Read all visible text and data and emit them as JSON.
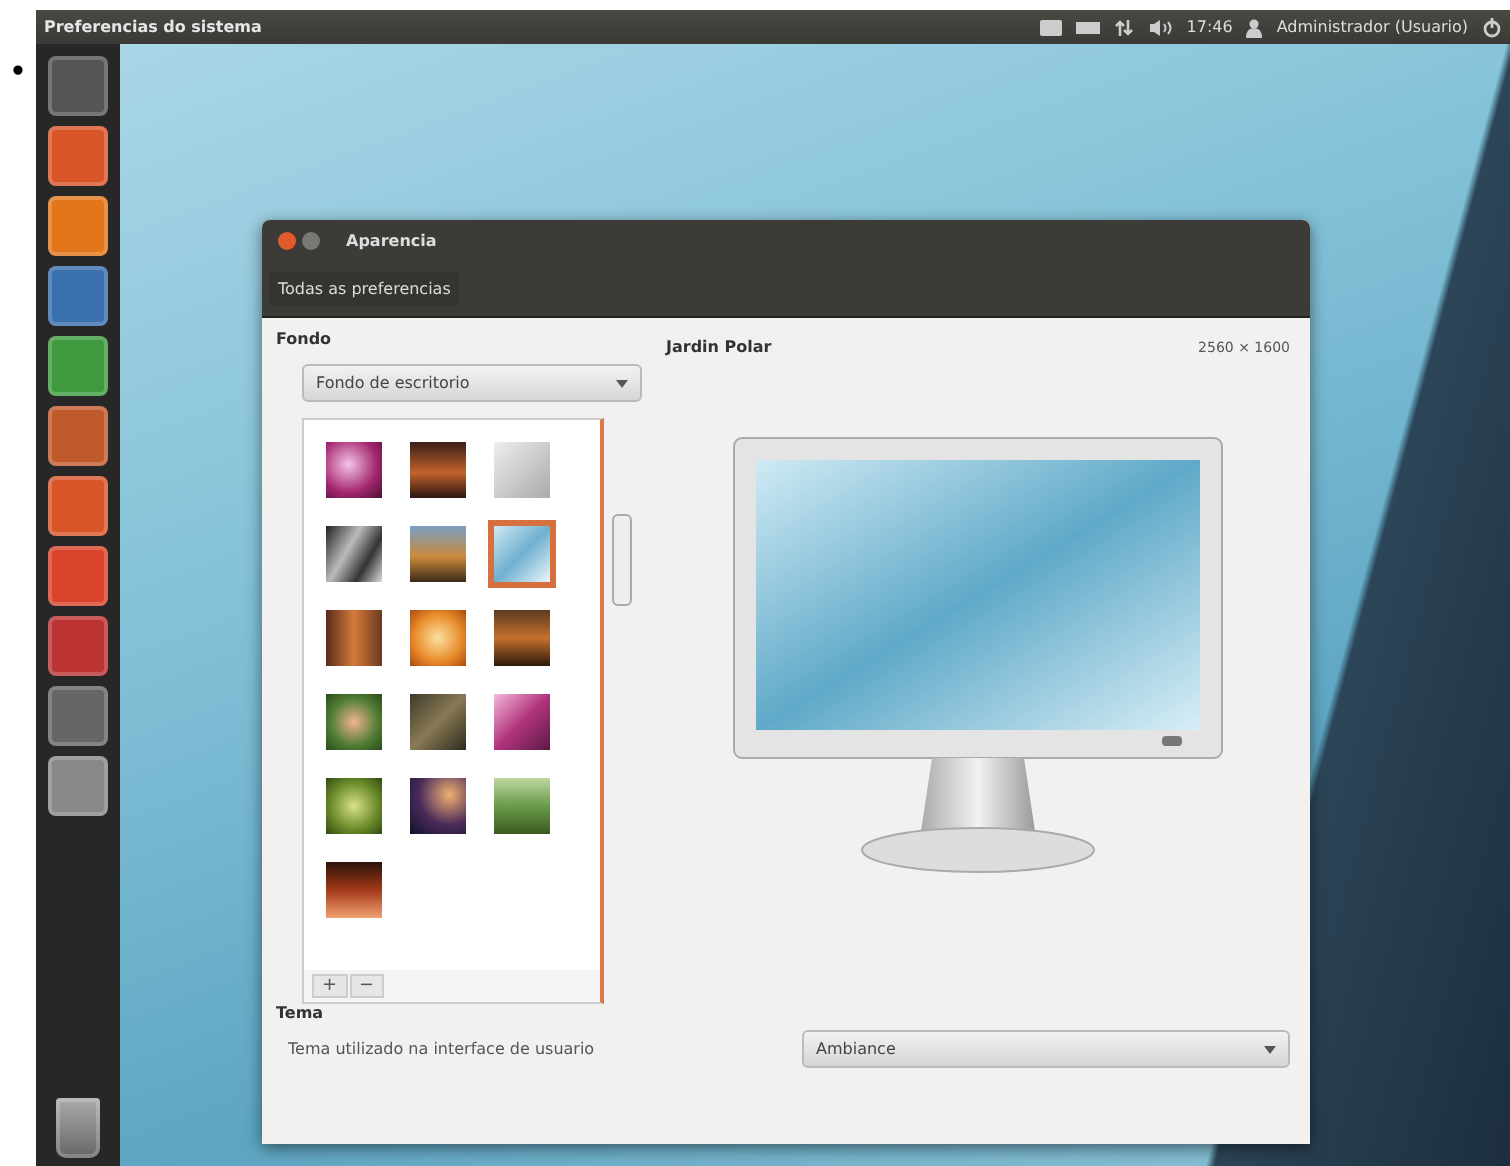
{
  "bullet": "•",
  "top_bar": {
    "title": "Preferencias do sistema",
    "clock": "17:46",
    "user": "Administrador (Usuario)"
  },
  "window": {
    "title": "Aparencia",
    "toolbar_button": "Todas as preferencias"
  },
  "background": {
    "heading": "Fondo",
    "source": {
      "value": "Fondo de escritorio"
    },
    "name": "Jardin Polar",
    "size": "2560 × 1600",
    "wallpapers": [
      {
        "selected": false
      },
      {
        "selected": false
      },
      {
        "selected": false
      },
      {
        "selected": false
      },
      {
        "selected": false
      },
      {
        "selected": true
      },
      {
        "selected": false
      },
      {
        "selected": false
      },
      {
        "selected": false
      },
      {
        "selected": false
      },
      {
        "selected": false
      },
      {
        "selected": false
      },
      {
        "selected": false
      },
      {
        "selected": false
      },
      {
        "selected": false
      },
      {
        "selected": false
      }
    ],
    "add_button": "+",
    "remove_button": "−"
  },
  "theme": {
    "heading": "Tema",
    "label": "Tema utilizado na interface de usuario",
    "value": "Ambiance"
  }
}
